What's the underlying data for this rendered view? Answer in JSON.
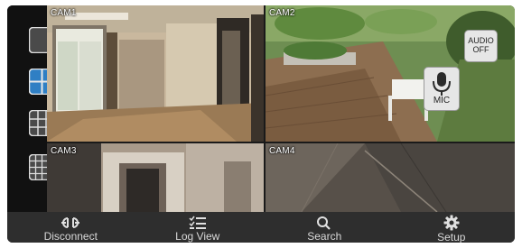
{
  "cameras": [
    {
      "label": "CAM1"
    },
    {
      "label": "CAM2"
    },
    {
      "label": "CAM3"
    },
    {
      "label": "CAM4"
    }
  ],
  "layout_buttons": [
    {
      "icon": "single-view-icon",
      "selected": false
    },
    {
      "icon": "quad-view-icon",
      "selected": true
    },
    {
      "icon": "nine-view-icon",
      "selected": false
    },
    {
      "icon": "sixteen-view-icon",
      "selected": false
    }
  ],
  "overlay": {
    "audio_line1": "AUDIO",
    "audio_line2": "OFF",
    "mic_label": "MIC"
  },
  "toolbar": {
    "items": [
      {
        "label": "Disconnect",
        "icon": "disconnect-icon"
      },
      {
        "label": "Log View",
        "icon": "log-list-icon"
      },
      {
        "label": "Search",
        "icon": "search-icon"
      },
      {
        "label": "Setup",
        "icon": "gear-icon"
      }
    ]
  },
  "colors": {
    "toolbar_bg": "#2e2e2e",
    "selected_layout": "#2f7fc4",
    "unselected_layout": "#4a4a4a"
  }
}
